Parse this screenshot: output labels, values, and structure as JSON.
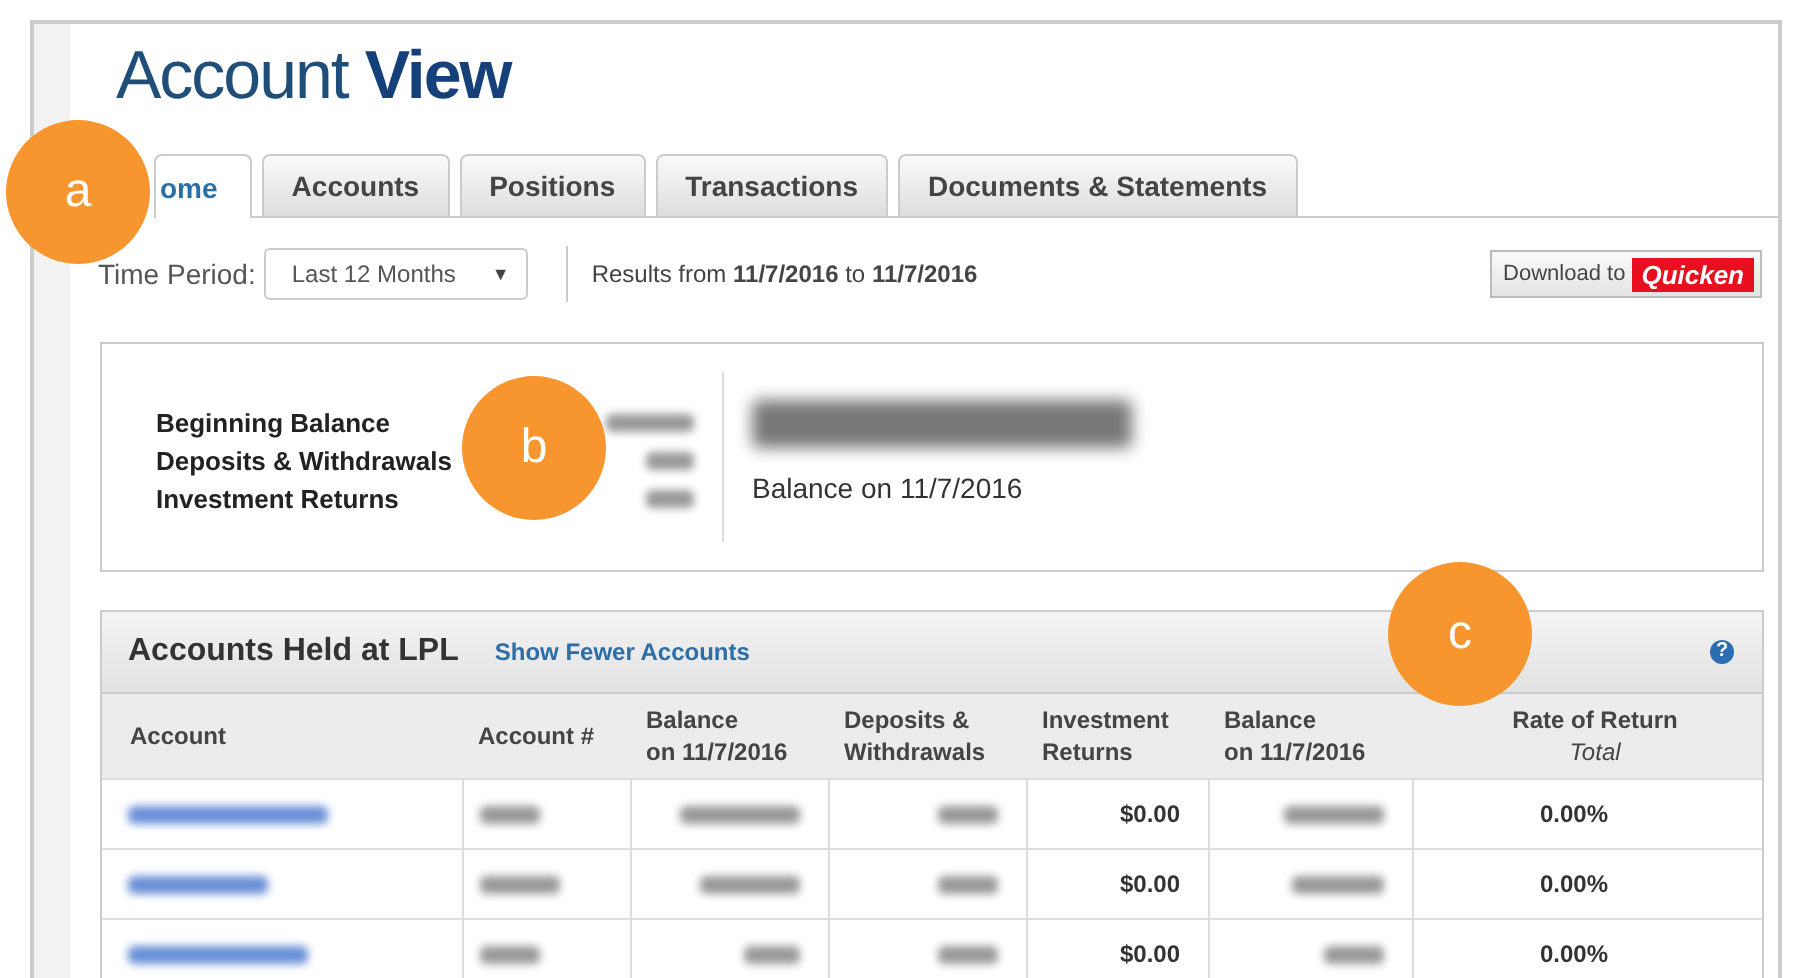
{
  "header": {
    "title_light": "Account",
    "title_bold": "View"
  },
  "tabs": [
    {
      "label": "ome",
      "selected": true
    },
    {
      "label": "Accounts",
      "selected": false
    },
    {
      "label": "Positions",
      "selected": false
    },
    {
      "label": "Transactions",
      "selected": false
    },
    {
      "label": "Documents & Statements",
      "selected": false
    }
  ],
  "filter": {
    "label": "Time Period:",
    "period": "Last 12 Months",
    "caret": "▼",
    "results_text": "Results from **11/7/2016** to **11/7/2016**",
    "download_label": "Download to",
    "download_brand": "Quicken"
  },
  "summary": {
    "items": [
      {
        "label": "Beginning Balance"
      },
      {
        "label": "Deposits & Withdrawals"
      },
      {
        "label": "Investment Returns"
      }
    ],
    "balance_caption": "Balance on 11/7/2016"
  },
  "accounts_panel": {
    "title": "Accounts Held at LPL",
    "link": "Show Fewer Accounts",
    "help": "?",
    "columns": [
      {
        "label": "Account"
      },
      {
        "label": "Account #"
      },
      {
        "label": "Balance",
        "line2": "on 11/7/2016"
      },
      {
        "label": "Deposits &",
        "line2": "Withdrawals"
      },
      {
        "label": "Investment",
        "line2": "Returns"
      },
      {
        "label": "Balance",
        "line2": "on 11/7/2016"
      },
      {
        "label": "Rate of Return",
        "line2": "Total"
      }
    ],
    "rows": [
      {
        "investment_returns": "$0.00",
        "rate_of_return": "0.00%"
      },
      {
        "investment_returns": "$0.00",
        "rate_of_return": "0.00%"
      },
      {
        "investment_returns": "$0.00",
        "rate_of_return": "0.00%"
      }
    ]
  },
  "callouts": [
    {
      "letter": "a"
    },
    {
      "letter": "b"
    },
    {
      "letter": "c"
    }
  ]
}
